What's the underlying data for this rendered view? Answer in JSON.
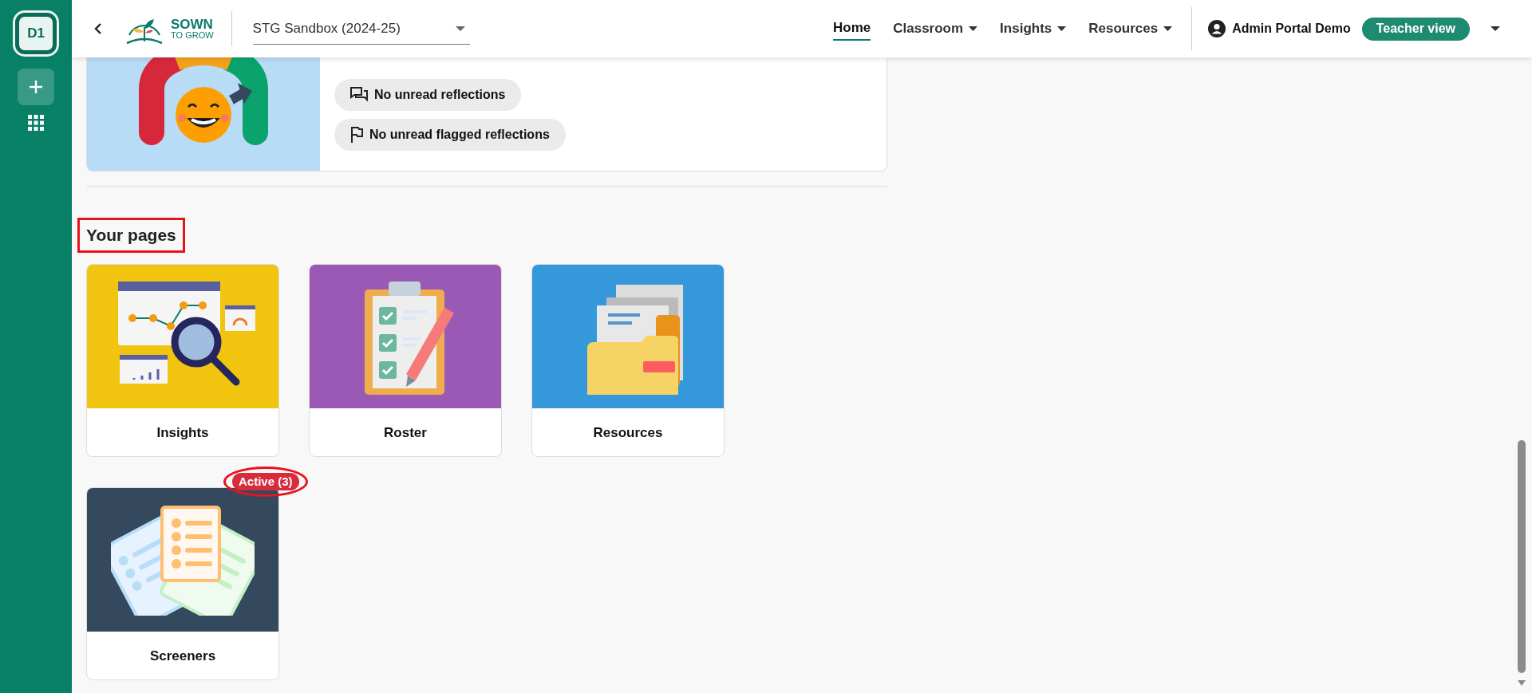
{
  "rail": {
    "workspace": "D1",
    "workspace_selected": true
  },
  "header": {
    "logo": {
      "line1": "SOWN",
      "line2": "TO GROW"
    },
    "class_select": {
      "value": "STG Sandbox (2024-25)"
    },
    "nav": [
      {
        "label": "Home",
        "selected": true,
        "has_menu": false
      },
      {
        "label": "Classroom",
        "selected": false,
        "has_menu": true
      },
      {
        "label": "Insights",
        "selected": false,
        "has_menu": true
      },
      {
        "label": "Resources",
        "selected": false,
        "has_menu": true
      }
    ],
    "user": {
      "name": "Admin Portal Demo",
      "view_button": "Teacher view"
    }
  },
  "summary_card": {
    "chips": [
      {
        "kind": "reflections",
        "label": "No unread reflections"
      },
      {
        "kind": "flagged",
        "label": "No unread flagged reflections"
      }
    ]
  },
  "pages_section": {
    "title": "Your pages",
    "title_highlighted": true,
    "tiles": [
      {
        "kind": "insights",
        "label": "Insights"
      },
      {
        "kind": "roster",
        "label": "Roster"
      },
      {
        "kind": "resources",
        "label": "Resources"
      },
      {
        "kind": "screeners",
        "label": "Screeners",
        "badge": "Active (3)",
        "badge_highlighted": true
      }
    ]
  }
}
